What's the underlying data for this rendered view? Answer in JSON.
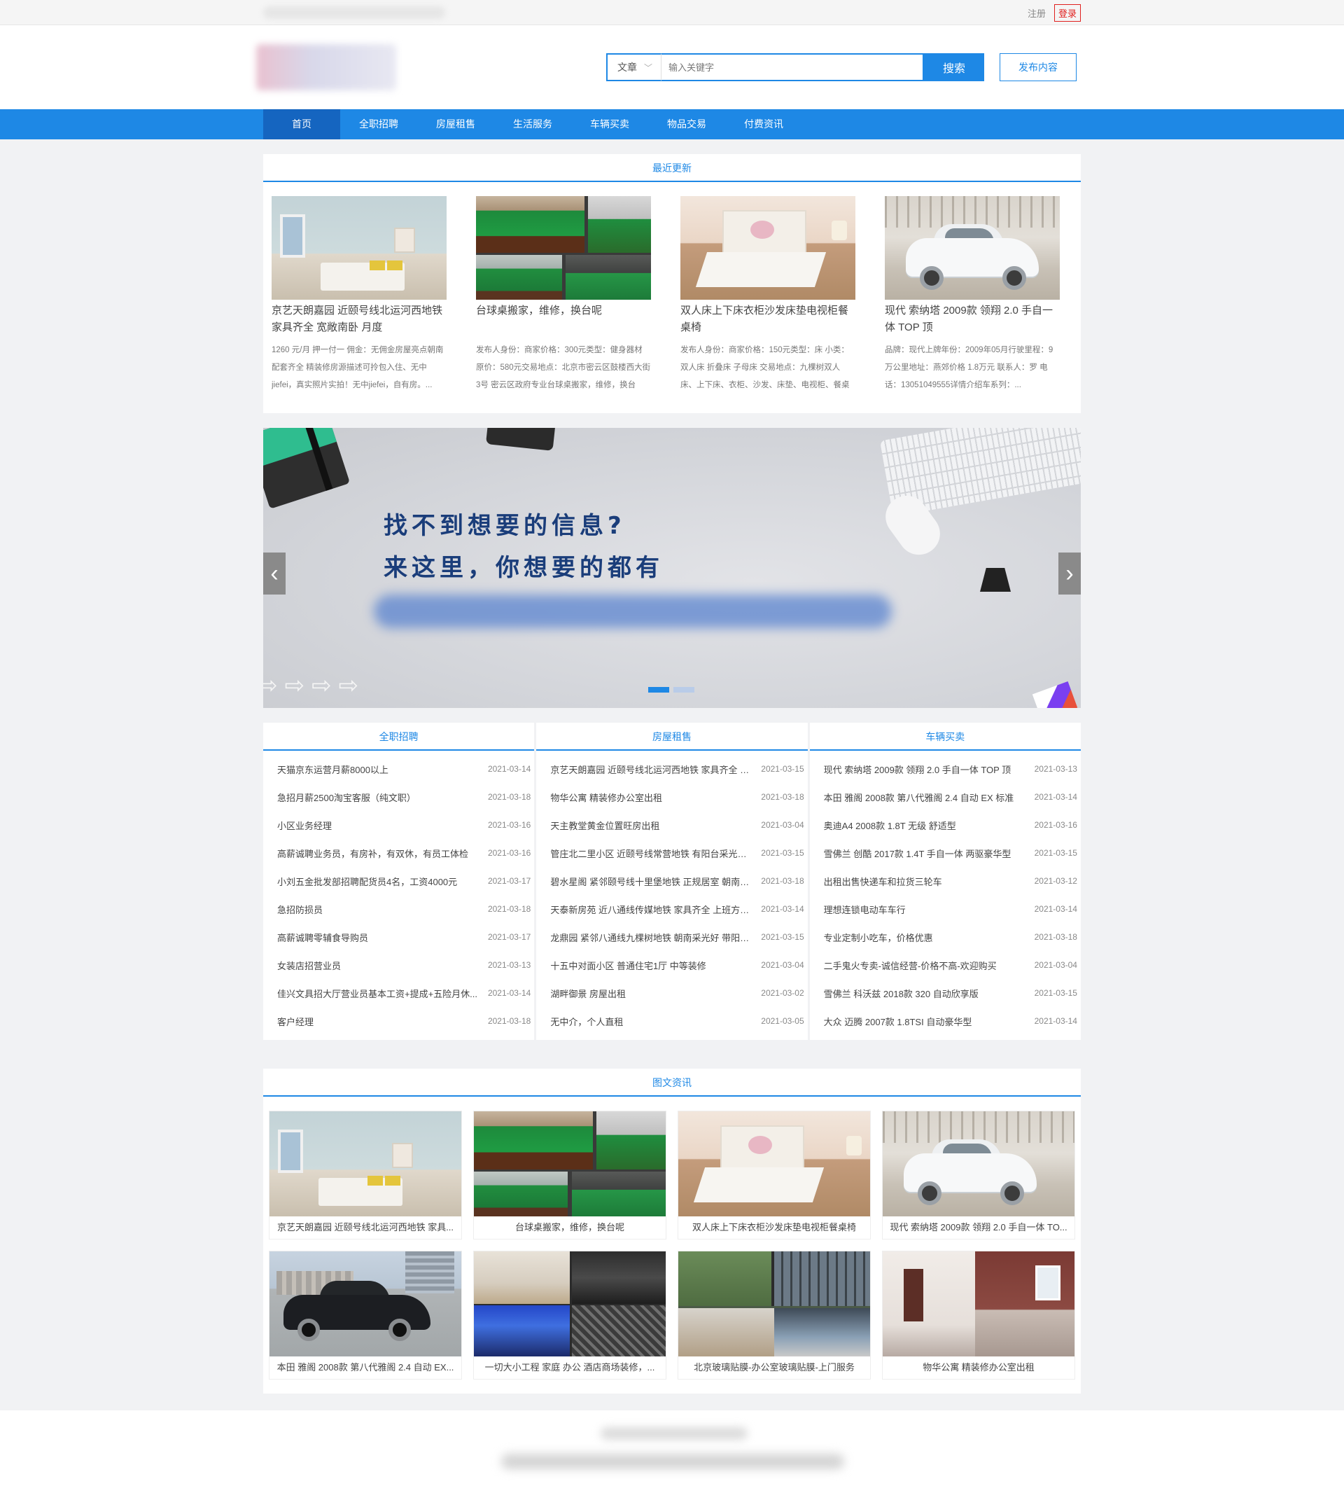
{
  "topbar": {
    "register": "注册",
    "login": "登录"
  },
  "search": {
    "category": "文章",
    "placeholder": "输入关键字",
    "button": "搜索"
  },
  "header": {
    "publish": "发布内容"
  },
  "nav": [
    "首页",
    "全职招聘",
    "房屋租售",
    "生活服务",
    "车辆买卖",
    "物品交易",
    "付费资讯"
  ],
  "latest": {
    "title": "最近更新",
    "items": [
      {
        "title": "京艺天朗嘉园 近颐号线北运河西地铁 家具齐全 宽敞南卧 月度",
        "desc": "1260 元/月 押一付一 佣金：无佣金房屋亮点朝南 配套齐全 精装修房源描述可拎包入住、无中 jiefei，真实照片实拍！无中jiefei，自有房。..."
      },
      {
        "title": "台球桌搬家，维修，换台呢",
        "desc": "发布人身份：商家价格：300元类型：健身器材 原价：580元交易地点：北京市密云区鼓楼西大街3号 密云区政府专业台球桌搬家，维修，换台呢，随..."
      },
      {
        "title": "双人床上下床衣柜沙发床垫电视柜餐桌椅",
        "desc": "发布人身份：商家价格：150元类型：床 小类：双人床 折叠床 子母床 交易地点：九棵树双人床、上下床、衣柜、沙发、床垫、电视柜、餐桌椅双..."
      },
      {
        "title": "现代 索纳塔 2009款 领翔 2.0 手自一体 TOP 顶",
        "desc": "品牌：现代上牌年份：2009年05月行驶里程：9万公里地址：燕郊价格 1.8万元 联系人：罗 电话：13051049555详情介绍车系列：..."
      }
    ]
  },
  "banner": {
    "line1": "找不到想要的信息?",
    "line2": "来这里，你想要的都有"
  },
  "lists": [
    {
      "title": "全职招聘",
      "items": [
        {
          "t": "天猫京东运营月薪8000以上",
          "d": "2021-03-14"
        },
        {
          "t": "急招月薪2500淘宝客服（纯文职）",
          "d": "2021-03-18"
        },
        {
          "t": "小区业务经理",
          "d": "2021-03-16"
        },
        {
          "t": "高薪诚聘业务员，有房补，有双休，有员工体检",
          "d": "2021-03-16"
        },
        {
          "t": "小刘五金批发部招聘配货员4名，工资4000元",
          "d": "2021-03-17"
        },
        {
          "t": "急招防损员",
          "d": "2021-03-18"
        },
        {
          "t": "高薪诚聘零辅食导购员",
          "d": "2021-03-17"
        },
        {
          "t": "女装店招营业员",
          "d": "2021-03-13"
        },
        {
          "t": "佳兴文具招大厅营业员基本工资+提成+五险月休...",
          "d": "2021-03-14"
        },
        {
          "t": "客户经理",
          "d": "2021-03-18"
        }
      ]
    },
    {
      "title": "房屋租售",
      "items": [
        {
          "t": "京艺天朗嘉园 近颐号线北运河西地铁 家具齐全 宽...",
          "d": "2021-03-15"
        },
        {
          "t": "物华公寓 精装修办公室出租",
          "d": "2021-03-18"
        },
        {
          "t": "天主教堂黄金位置旺房出租",
          "d": "2021-03-04"
        },
        {
          "t": "管庄北二里小区 近颐号线常营地铁 有阳台采光好 ...",
          "d": "2021-03-15"
        },
        {
          "t": "碧水星阁 紧邻颐号线十里堡地铁 正规居室 朝南采...",
          "d": "2021-03-18"
        },
        {
          "t": "天泰新房苑 近八通线传媒地铁 家具齐全 上班方便...",
          "d": "2021-03-14"
        },
        {
          "t": "龙鼎园 紧邻八通线九棵树地铁 朝南采光好 带阳台...",
          "d": "2021-03-15"
        },
        {
          "t": "十五中对面小区 普通住宅1厅 中等装修",
          "d": "2021-03-04"
        },
        {
          "t": "湖畔御景 房屋出租",
          "d": "2021-03-02"
        },
        {
          "t": "无中介，个人直租",
          "d": "2021-03-05"
        }
      ]
    },
    {
      "title": "车辆买卖",
      "items": [
        {
          "t": "现代 索纳塔 2009款 领翔 2.0 手自一体 TOP 顶",
          "d": "2021-03-13"
        },
        {
          "t": "本田 雅阁 2008款 第八代雅阁 2.4 自动 EX 标准",
          "d": "2021-03-14"
        },
        {
          "t": "奥迪A4 2008款 1.8T 无级 舒适型",
          "d": "2021-03-16"
        },
        {
          "t": "雪佛兰 创酷 2017款 1.4T 手自一体 两驱豪华型",
          "d": "2021-03-15"
        },
        {
          "t": "出租出售快递车和拉货三轮车",
          "d": "2021-03-12"
        },
        {
          "t": "理想连锁电动车车行",
          "d": "2021-03-14"
        },
        {
          "t": "专业定制小吃车，价格优惠",
          "d": "2021-03-18"
        },
        {
          "t": "二手鬼火专卖-诚信经营-价格不高-欢迎购买",
          "d": "2021-03-04"
        },
        {
          "t": "雪佛兰 科沃兹 2018款 320 自动欣享版",
          "d": "2021-03-15"
        },
        {
          "t": "大众 迈腾 2007款 1.8TSI 自动豪华型",
          "d": "2021-03-14"
        }
      ]
    }
  ],
  "gallery": {
    "title": "图文资讯",
    "items": [
      {
        "cap": "京艺天朗嘉园 近颐号线北运河西地铁 家具...",
        "img": "bedroom"
      },
      {
        "cap": "台球桌搬家，维修，换台呢",
        "img": "pool"
      },
      {
        "cap": "双人床上下床衣柜沙发床垫电视柜餐桌椅",
        "img": "bed2"
      },
      {
        "cap": "现代 索纳塔 2009款 领翔 2.0 手自一体 TO...",
        "img": "car-w"
      },
      {
        "cap": "本田 雅阁 2008款 第八代雅阁 2.4 自动 EX...",
        "img": "car-b"
      },
      {
        "cap": "一切大小工程 家庭 办公 酒店商场装修，...",
        "img": "reno"
      },
      {
        "cap": "北京玻璃贴膜-办公室玻璃贴膜-上门服务",
        "img": "glass"
      },
      {
        "cap": "物华公寓 精装修办公室出租",
        "img": "apt"
      }
    ]
  },
  "colors": {
    "accent": "#1e88e5",
    "nav_active": "#1565c0",
    "login_red": "#e0201e",
    "page_bg": "#f1f2f4"
  }
}
